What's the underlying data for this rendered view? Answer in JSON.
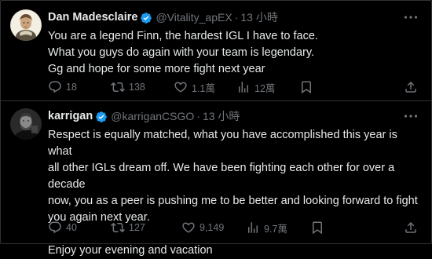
{
  "colors": {
    "background": "#000000",
    "text": "#e7e9ea",
    "muted": "#71767b",
    "verified": "#1d9bf0",
    "divider": "#2f3336"
  },
  "tweets": [
    {
      "author": {
        "name": "Dan Madesclaire",
        "handle": "@Vitality_apEX",
        "verified": true,
        "avatar_icon": "avatar-dan-madesclaire"
      },
      "separator": "·",
      "time": "13 小時",
      "body": [
        "You are a legend Finn, the hardest IGL I have to face.",
        "What you guys do again with your team is legendary.",
        "Gg and hope for some more fight next year"
      ],
      "actions": {
        "replies": "18",
        "retweets": "138",
        "likes": "1.1萬",
        "views": "12萬"
      }
    },
    {
      "author": {
        "name": "karrigan",
        "handle": "@karriganCSGO",
        "verified": true,
        "avatar_icon": "avatar-karrigan"
      },
      "separator": "·",
      "time": "13 小時",
      "body": [
        "Respect is equally matched, what you have accomplished this year is what",
        "all other IGLs dream off. We have been fighting each other for over a decade",
        "now, you as a peer is pushing me to be better and looking forward to fight",
        "you again next year."
      ],
      "body_extra": "Enjoy your evening and vacation",
      "actions": {
        "replies": "40",
        "retweets": "127",
        "likes": "9,149",
        "views": "9.7萬"
      }
    }
  ]
}
